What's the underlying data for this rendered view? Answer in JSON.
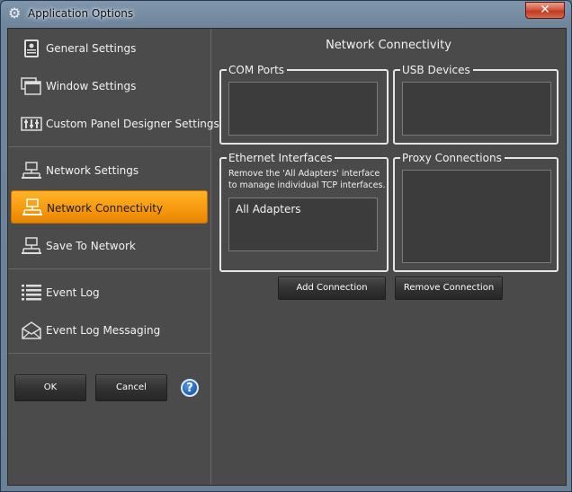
{
  "window": {
    "title": "Application Options",
    "close_symbol": "✕"
  },
  "sidebar": {
    "items": [
      {
        "label": "General Settings",
        "icon": "general-settings-icon"
      },
      {
        "label": "Window Settings",
        "icon": "window-settings-icon"
      },
      {
        "label": "Custom Panel Designer Settings",
        "icon": "panel-designer-icon"
      },
      {
        "label": "Network Settings",
        "icon": "network-icon"
      },
      {
        "label": "Network Connectivity",
        "icon": "network-icon",
        "active": true
      },
      {
        "label": "Save To Network",
        "icon": "network-icon"
      },
      {
        "label": "Event Log",
        "icon": "list-icon"
      },
      {
        "label": "Event Log Messaging",
        "icon": "envelope-icon"
      }
    ],
    "ok_label": "OK",
    "cancel_label": "Cancel",
    "help_symbol": "?"
  },
  "main": {
    "title": "Network Connectivity",
    "com_ports": {
      "title": "COM Ports"
    },
    "usb_devices": {
      "title": "USB Devices"
    },
    "ethernet": {
      "title": "Ethernet Interfaces",
      "description": "Remove the 'All Adapters' interface to manage individual TCP interfaces.",
      "items": [
        "All Adapters"
      ]
    },
    "proxy": {
      "title": "Proxy Connections"
    },
    "add_connection_label": "Add Connection",
    "remove_connection_label": "Remove Connection"
  },
  "colors": {
    "accent": "#f79a10",
    "panel_bg": "#4a4a4a",
    "close_red": "#c0391f"
  }
}
